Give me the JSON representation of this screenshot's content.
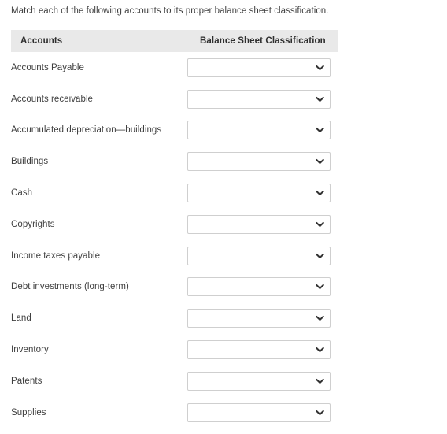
{
  "prompt": {
    "text": "Match each of the following accounts to its proper balance sheet classification."
  },
  "table": {
    "headers": {
      "accounts": "Accounts",
      "classification": "Balance Sheet Classification"
    },
    "select_placeholder": "",
    "rows": [
      {
        "account": "Accounts Payable",
        "selected": ""
      },
      {
        "account": "Accounts receivable",
        "selected": ""
      },
      {
        "account": "Accumulated depreciation—buildings",
        "selected": ""
      },
      {
        "account": "Buildings",
        "selected": ""
      },
      {
        "account": "Cash",
        "selected": ""
      },
      {
        "account": "Copyrights",
        "selected": ""
      },
      {
        "account": "Income taxes payable",
        "selected": ""
      },
      {
        "account": "Debt investments (long-term)",
        "selected": ""
      },
      {
        "account": "Land",
        "selected": ""
      },
      {
        "account": "Inventory",
        "selected": ""
      },
      {
        "account": "Patents",
        "selected": ""
      },
      {
        "account": "Supplies",
        "selected": ""
      }
    ]
  },
  "icons": {
    "dropdown": "chevron-down-icon"
  },
  "colors": {
    "header_band": "#e9e9e9",
    "text": "#3f3f3f",
    "header_text": "#2f2f2f",
    "select_border": "#cfcfcf",
    "page_background": "#ffffff"
  }
}
